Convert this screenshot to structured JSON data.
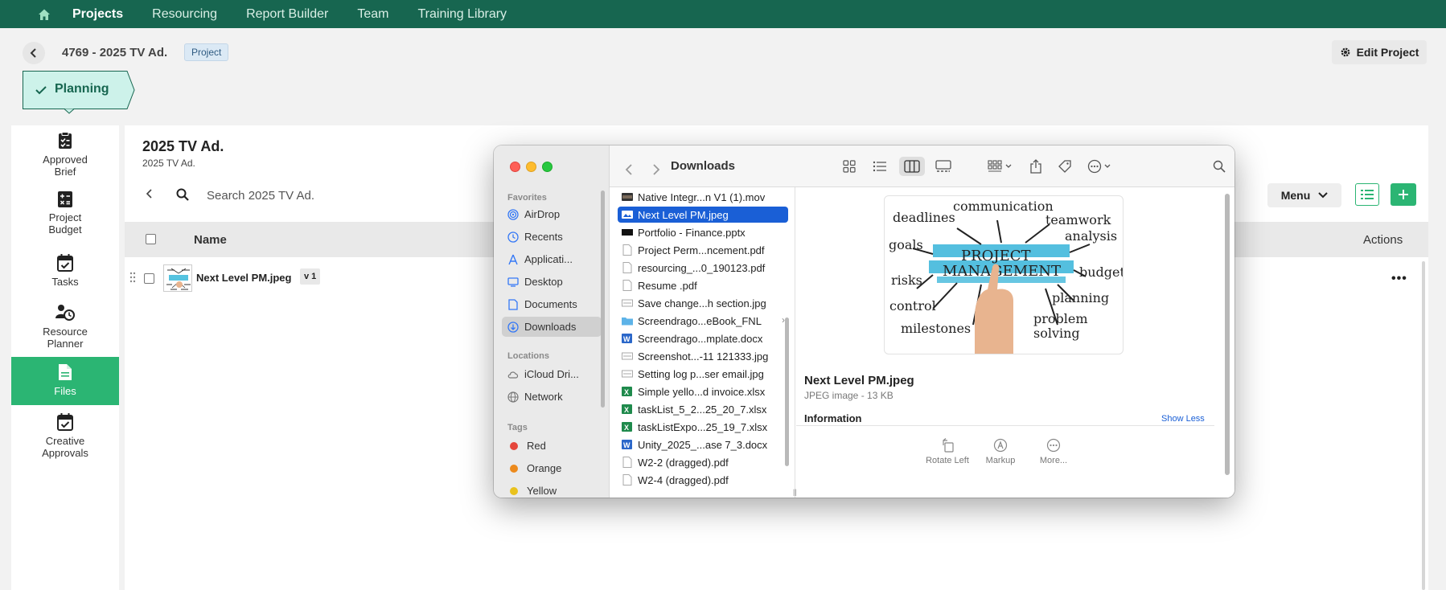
{
  "topnav": {
    "home_icon": "home-icon",
    "items": [
      {
        "label": "Projects",
        "active": true
      },
      {
        "label": "Resourcing"
      },
      {
        "label": "Report Builder"
      },
      {
        "label": "Team"
      },
      {
        "label": "Training Library"
      }
    ]
  },
  "header": {
    "title": "4769 - 2025 TV Ad.",
    "badge": "Project",
    "edit_label": "Edit Project",
    "stage": "Planning"
  },
  "sidebar": {
    "items": [
      {
        "label": "Approved Brief",
        "icon": "checklist-icon"
      },
      {
        "label": "Project Budget",
        "icon": "calculator-icon"
      },
      {
        "label": "Tasks",
        "icon": "calendar-check-icon"
      },
      {
        "label": "Resource Planner",
        "icon": "people-clock-icon"
      },
      {
        "label": "Files",
        "icon": "file-icon",
        "active": true
      },
      {
        "label": "Creative Approvals",
        "icon": "calendar-check-icon"
      }
    ]
  },
  "main": {
    "title": "2025 TV Ad.",
    "subtitle": "2025 TV Ad.",
    "search_placeholder": "Search 2025 TV Ad.",
    "menu_label": "Menu",
    "columns": {
      "name": "Name",
      "actions": "Actions"
    },
    "rows": [
      {
        "name": "Next Level PM.jpeg",
        "version": "v 1"
      }
    ]
  },
  "finder": {
    "title": "Downloads",
    "sections": {
      "favorites": "Favorites",
      "locations": "Locations",
      "tags": "Tags"
    },
    "favorites": [
      {
        "label": "AirDrop",
        "icon": "airdrop-icon"
      },
      {
        "label": "Recents",
        "icon": "clock-icon"
      },
      {
        "label": "Applicati...",
        "icon": "applications-icon"
      },
      {
        "label": "Desktop",
        "icon": "desktop-icon"
      },
      {
        "label": "Documents",
        "icon": "document-icon"
      },
      {
        "label": "Downloads",
        "icon": "download-icon",
        "selected": true
      }
    ],
    "locations": [
      {
        "label": "iCloud Dri...",
        "icon": "cloud-icon"
      },
      {
        "label": "Network",
        "icon": "globe-icon"
      }
    ],
    "tags": [
      {
        "label": "Red",
        "color": "#e5463b"
      },
      {
        "label": "Orange",
        "color": "#ec8a1d"
      },
      {
        "label": "Yellow",
        "color": "#e9c21d"
      }
    ],
    "files": [
      {
        "name": "Native Integr...n V1 (1).mov",
        "kind": "movie"
      },
      {
        "name": "Next Level PM.jpeg",
        "kind": "image",
        "selected": true
      },
      {
        "name": "Portfolio - Finance.pptx",
        "kind": "pptx"
      },
      {
        "name": "Project Perm...ncement.pdf",
        "kind": "pdf"
      },
      {
        "name": "resourcing_...0_190123.pdf",
        "kind": "pdf"
      },
      {
        "name": "Resume .pdf",
        "kind": "pdf"
      },
      {
        "name": "Save change...h section.jpg",
        "kind": "image"
      },
      {
        "name": "Screendrago...eBook_FNL",
        "kind": "folder"
      },
      {
        "name": "Screendrago...mplate.docx",
        "kind": "docx"
      },
      {
        "name": "Screenshot...-11 121333.jpg",
        "kind": "image"
      },
      {
        "name": "Setting log p...ser email.jpg",
        "kind": "image"
      },
      {
        "name": "Simple yello...d invoice.xlsx",
        "kind": "xlsx"
      },
      {
        "name": "taskList_5_2...25_20_7.xlsx",
        "kind": "xlsx"
      },
      {
        "name": "taskListExpo...25_19_7.xlsx",
        "kind": "xlsx"
      },
      {
        "name": "Unity_2025_...ase 7_3.docx",
        "kind": "docx"
      },
      {
        "name": "W2-2 (dragged).pdf",
        "kind": "pdf"
      },
      {
        "name": "W2-4 (dragged).pdf",
        "kind": "pdf"
      }
    ],
    "preview": {
      "name": "Next Level PM.jpeg",
      "kind": "JPEG image - 13 KB",
      "info_label": "Information",
      "show_less": "Show Less",
      "image_words": [
        "communication",
        "deadlines",
        "teamwork",
        "analysis",
        "goals",
        "PROJECT",
        "MANAGEMENT",
        "budget",
        "risks",
        "planning",
        "control",
        "milestones",
        "problem",
        "solving"
      ],
      "actions": [
        {
          "label": "Rotate Left",
          "icon": "rotate-left-icon"
        },
        {
          "label": "Markup",
          "icon": "markup-icon"
        },
        {
          "label": "More...",
          "icon": "more-icon"
        }
      ]
    }
  },
  "colors": {
    "nav_green": "#176650",
    "accent_green": "#2bb573",
    "finder_select_blue": "#1a5fd6"
  }
}
